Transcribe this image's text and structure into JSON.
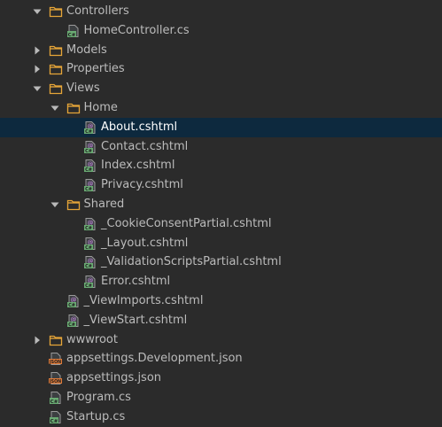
{
  "colors": {
    "background": "#2b2b2b",
    "selection": "#0d293e",
    "text": "#bbbbbb",
    "folder": "#e6a538",
    "cs_icon": "#6aab73",
    "razor_icon": "#b07fc9",
    "json_icon": "#e07b39"
  },
  "tree": [
    {
      "label": "Controllers",
      "depth": 0,
      "icon": "folder-icon",
      "expand": "expanded"
    },
    {
      "label": "HomeController.cs",
      "depth": 1,
      "icon": "csharp-file-icon",
      "expand": "none"
    },
    {
      "label": "Models",
      "depth": 0,
      "icon": "folder-icon",
      "expand": "collapsed"
    },
    {
      "label": "Properties",
      "depth": 0,
      "icon": "folder-icon",
      "expand": "collapsed"
    },
    {
      "label": "Views",
      "depth": 0,
      "icon": "folder-icon",
      "expand": "expanded"
    },
    {
      "label": "Home",
      "depth": 1,
      "icon": "folder-icon",
      "expand": "expanded"
    },
    {
      "label": "About.cshtml",
      "depth": 2,
      "icon": "razor-file-icon",
      "expand": "none",
      "selected": true
    },
    {
      "label": "Contact.cshtml",
      "depth": 2,
      "icon": "razor-file-icon",
      "expand": "none"
    },
    {
      "label": "Index.cshtml",
      "depth": 2,
      "icon": "razor-file-icon",
      "expand": "none"
    },
    {
      "label": "Privacy.cshtml",
      "depth": 2,
      "icon": "razor-file-icon",
      "expand": "none"
    },
    {
      "label": "Shared",
      "depth": 1,
      "icon": "folder-icon",
      "expand": "expanded"
    },
    {
      "label": "_CookieConsentPartial.cshtml",
      "depth": 2,
      "icon": "razor-file-icon",
      "expand": "none"
    },
    {
      "label": "_Layout.cshtml",
      "depth": 2,
      "icon": "razor-file-icon",
      "expand": "none"
    },
    {
      "label": "_ValidationScriptsPartial.cshtml",
      "depth": 2,
      "icon": "razor-file-icon",
      "expand": "none"
    },
    {
      "label": "Error.cshtml",
      "depth": 2,
      "icon": "razor-file-icon",
      "expand": "none"
    },
    {
      "label": "_ViewImports.cshtml",
      "depth": 1,
      "icon": "razor-file-icon",
      "expand": "none"
    },
    {
      "label": "_ViewStart.cshtml",
      "depth": 1,
      "icon": "razor-file-icon",
      "expand": "none"
    },
    {
      "label": "wwwroot",
      "depth": 0,
      "icon": "folder-icon",
      "expand": "collapsed"
    },
    {
      "label": "appsettings.Development.json",
      "depth": 0,
      "icon": "json-file-icon",
      "expand": "none"
    },
    {
      "label": "appsettings.json",
      "depth": 0,
      "icon": "json-file-icon",
      "expand": "none"
    },
    {
      "label": "Program.cs",
      "depth": 0,
      "icon": "csharp-file-icon",
      "expand": "none"
    },
    {
      "label": "Startup.cs",
      "depth": 0,
      "icon": "csharp-file-icon",
      "expand": "none"
    }
  ]
}
